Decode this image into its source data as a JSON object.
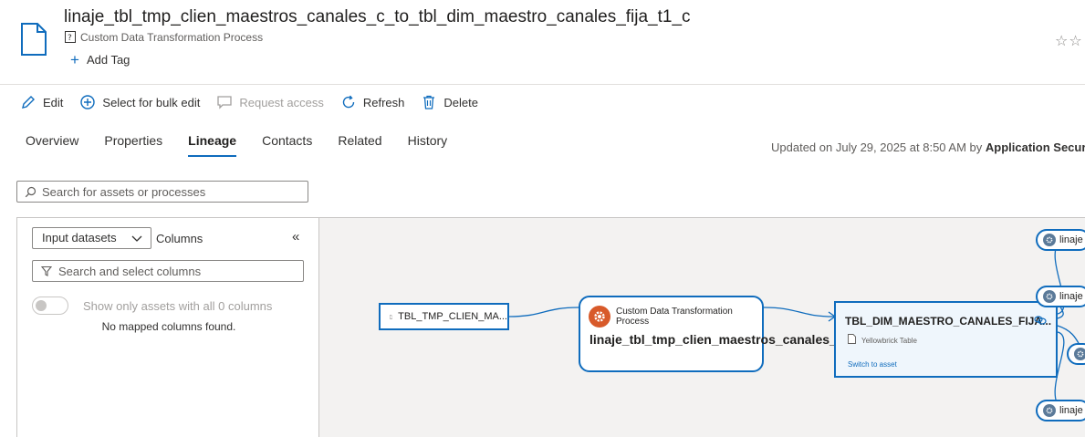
{
  "header": {
    "title": "linaje_tbl_tmp_clien_maestros_canales_c_to_tbl_dim_maestro_canales_fija_t1_c",
    "asset_type": "Custom Data Transformation Process",
    "add_tag_label": "Add Tag"
  },
  "toolbar": {
    "edit_label": "Edit",
    "bulk_edit_label": "Select for bulk edit",
    "request_access_label": "Request access",
    "refresh_label": "Refresh",
    "delete_label": "Delete"
  },
  "tabs": [
    {
      "label": "Overview"
    },
    {
      "label": "Properties"
    },
    {
      "label": "Lineage"
    },
    {
      "label": "Contacts"
    },
    {
      "label": "Related"
    },
    {
      "label": "History"
    }
  ],
  "active_tab": "Lineage",
  "updated": {
    "prefix": "Updated on July 29, 2025 at 8:50 AM by ",
    "user": "Application Securit"
  },
  "search": {
    "placeholder": "Search for assets or processes"
  },
  "columns_panel": {
    "dropdown_value": "Input datasets",
    "columns_label": "Columns",
    "collapse_glyph": "«",
    "search_placeholder": "Search and select columns",
    "toggle_label": "Show only assets with all 0 columns",
    "toggle_on": false,
    "empty_message": "No mapped columns found."
  },
  "lineage": {
    "source_node": {
      "label": "TBL_TMP_CLIEN_MA..."
    },
    "process_node": {
      "type": "Custom Data Transformation Process",
      "name": "linaje_tbl_tmp_clien_maestros_canales_c_to_tbl_d..."
    },
    "target_node": {
      "name": "TBL_DIM_MAESTRO_CANALES_FIJA...",
      "type": "Yellowbrick Table",
      "switch_label": "Switch to asset"
    },
    "related_processes": [
      {
        "label": "linaje"
      },
      {
        "label": "linaje"
      },
      {
        "label": "linaje"
      }
    ]
  },
  "colors": {
    "accent": "#0f6cbd",
    "process_icon": "#d85a2a",
    "canvas_bg": "#f3f2f1"
  },
  "icons": {
    "page": "file-icon",
    "edit": "pencil-icon",
    "bulk": "plus-circle-icon",
    "request": "chat-icon",
    "refresh": "refresh-icon",
    "delete": "trash-icon",
    "favorite": "star-icon"
  }
}
